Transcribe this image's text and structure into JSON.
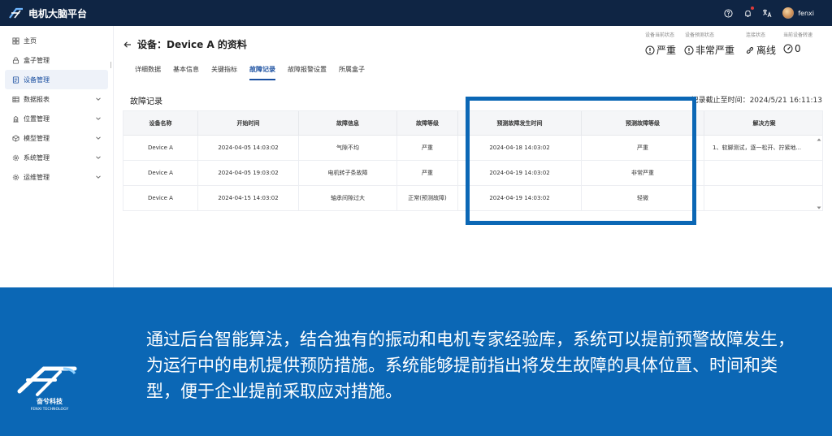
{
  "app": {
    "title": "电机大脑平台",
    "username": "fenxi"
  },
  "sidebar": {
    "items": [
      {
        "label": "主页",
        "icon": "home-icon",
        "active": false,
        "expandable": false
      },
      {
        "label": "盒子管理",
        "icon": "lock-icon",
        "active": false,
        "expandable": false
      },
      {
        "label": "设备管理",
        "icon": "device-icon",
        "active": true,
        "expandable": false
      },
      {
        "label": "数据报表",
        "icon": "table-icon",
        "active": false,
        "expandable": true
      },
      {
        "label": "位置管理",
        "icon": "location-icon",
        "active": false,
        "expandable": true
      },
      {
        "label": "模型管理",
        "icon": "model-icon",
        "active": false,
        "expandable": true
      },
      {
        "label": "系统管理",
        "icon": "gear-icon",
        "active": false,
        "expandable": true
      },
      {
        "label": "运维管理",
        "icon": "gear-icon",
        "active": false,
        "expandable": true
      }
    ]
  },
  "page": {
    "title": "设备：Device A 的资料"
  },
  "status": {
    "labels": [
      "设备当前状态",
      "设备预测状态",
      "连接状态",
      "当前设备转速"
    ],
    "current": "严重",
    "predicted": "非常严重",
    "connection": "离线",
    "speed": "0"
  },
  "tabs": [
    {
      "label": "详细数据",
      "active": false
    },
    {
      "label": "基本信息",
      "active": false
    },
    {
      "label": "关键指标",
      "active": false
    },
    {
      "label": "故障记录",
      "active": true
    },
    {
      "label": "故障报警设置",
      "active": false
    },
    {
      "label": "所属盒子",
      "active": false
    }
  ],
  "section": {
    "title": "故障记录",
    "deadline": "记录截止至时间：2024/5/21 16:11:13"
  },
  "table": {
    "headers": [
      "设备名称",
      "开始时间",
      "故障信息",
      "故障等级",
      "预测故障发生时间",
      "预测故障等级",
      "解决方案"
    ],
    "rows": [
      [
        "Device A",
        "2024-04-05 14:03:02",
        "气隙不均",
        "严重",
        "2024-04-18 14:03:02",
        "严重",
        "1、软脚测试，逐一松开、拧紧地..."
      ],
      [
        "Device A",
        "2024-04-05 19:03:02",
        "电机转子条故障",
        "严重",
        "2024-04-19 14:03:02",
        "非常严重",
        ""
      ],
      [
        "Device A",
        "2024-04-15 14:03:02",
        "轴承间隙过大",
        "正常(预测故障)",
        "2024-04-19 14:03:02",
        "轻微",
        ""
      ]
    ]
  },
  "colors": {
    "header_bg": "#0f2544",
    "accent": "#1a4fa0",
    "banner_bg": "#0b67b5",
    "highlight": "#0b67b5"
  },
  "banner": {
    "text": "通过后台智能算法，结合独有的振动和电机专家经验库，系统可以提前预警故障发生，为运行中的电机提供预防措施。系统能够提前指出将发生故障的具体位置、时间和类型，便于企业提前采取应对措施。",
    "logo_cn": "奋兮科技",
    "logo_en": "FENXI TECHNOLOGY"
  }
}
